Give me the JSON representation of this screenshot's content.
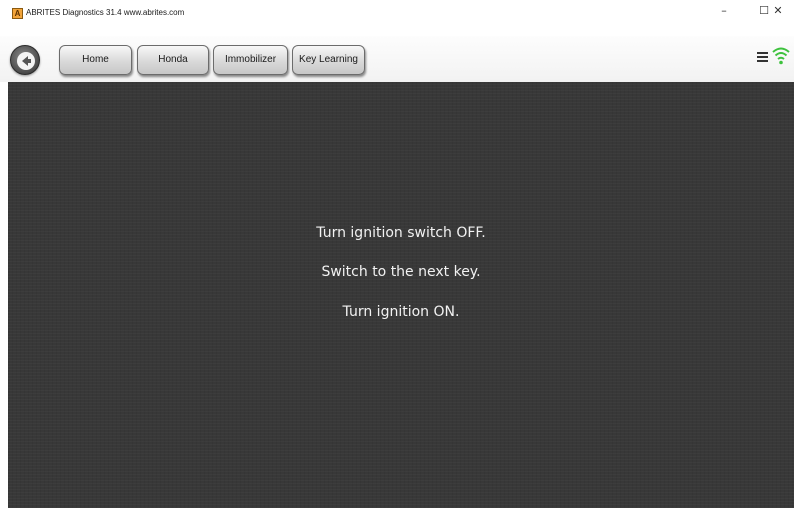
{
  "window": {
    "title": "ABRITES Diagnostics 31.4  www.abrites.com",
    "app_icon_letter": "A",
    "minimize_glyph": "–",
    "maximize_glyph": "☐",
    "close_glyph": "✕"
  },
  "toolbar": {
    "back_icon": "back-arrow-icon",
    "buttons": [
      {
        "label": "Home"
      },
      {
        "label": "Honda"
      },
      {
        "label": "Immobilizer"
      },
      {
        "label": "Key Learning"
      }
    ],
    "menu_icon": "hamburger-menu-icon",
    "status_icon": "wifi-connected-icon",
    "status_color": "#3ec23e"
  },
  "main": {
    "messages": [
      "Turn ignition switch OFF.",
      "Switch to the next key.",
      "Turn ignition ON."
    ],
    "background_color": "#383838"
  }
}
